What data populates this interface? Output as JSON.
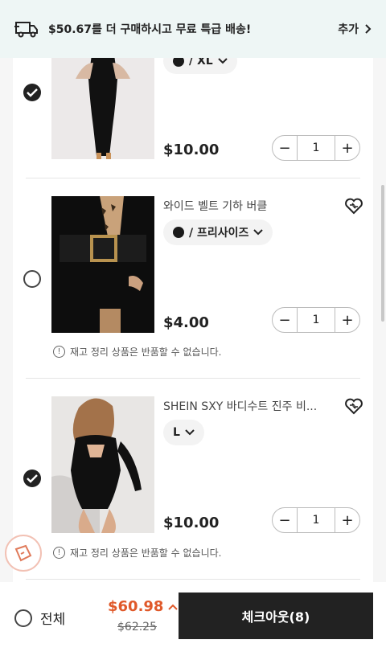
{
  "banner": {
    "text": "$50.67를 더 구매하시고 무료 특급 배송!",
    "add_label": "추가"
  },
  "items": [
    {
      "selected": true,
      "variant": "/ XL",
      "price": "$10.00",
      "qty": "1"
    },
    {
      "selected": false,
      "title": "와이드 벨트 기하 버클",
      "variant": "/ 프리사이즈",
      "price": "$4.00",
      "qty": "1",
      "notice": "재고 정리 상품은 반품할 수 없습니다."
    },
    {
      "selected": true,
      "title": "SHEIN SXY 바디수트 진주 비...",
      "variant": "L",
      "price": "$10.00",
      "qty": "1",
      "notice": "재고 정리 상품은 반품할 수 없습니다."
    }
  ],
  "footer": {
    "select_all": "전체",
    "total": "$60.98",
    "original": "$62.25",
    "checkout": "체크아웃(8)"
  },
  "colors": {
    "accent": "#e0592a",
    "dark": "#222222",
    "banner_bg": "#eef6f5"
  }
}
